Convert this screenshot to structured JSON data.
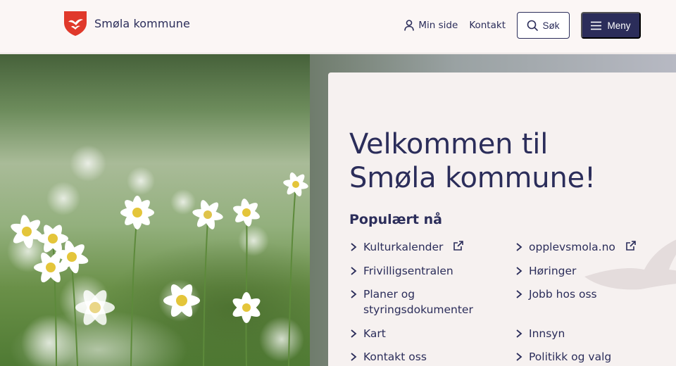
{
  "header": {
    "brand": "Smøla kommune",
    "nav": {
      "min_side": "Min side",
      "kontakt": "Kontakt",
      "search": "Søk",
      "menu": "Meny"
    }
  },
  "hero": {
    "heading_line1": "Velkommen til",
    "heading_line2": "Smøla kommune!",
    "popular_title": "Populært nå",
    "links_left": [
      {
        "label": "Kulturkalender",
        "external": true
      },
      {
        "label": "Frivilligsentralen",
        "external": false
      },
      {
        "label": "Planer og",
        "label2": "styringsdokumenter",
        "external": false
      },
      {
        "label": "Kart",
        "external": false
      },
      {
        "label": "Kontakt oss",
        "external": false
      }
    ],
    "links_right": [
      {
        "label": "opplevsmola.no",
        "external": true
      },
      {
        "label": "Høringer",
        "external": false
      },
      {
        "label": "Jobb hos oss",
        "external": false
      },
      {
        "label": "Innsyn",
        "external": false
      },
      {
        "label": "Politikk og valg",
        "external": false
      }
    ]
  },
  "colors": {
    "navy": "#2b2d5a",
    "background": "#f8f3f2",
    "shield_red": "#e0392b"
  },
  "icons": [
    "shield-logo",
    "person-icon",
    "search-icon",
    "hamburger-icon",
    "chevron-right-icon",
    "external-link-icon",
    "bird-watermark"
  ]
}
